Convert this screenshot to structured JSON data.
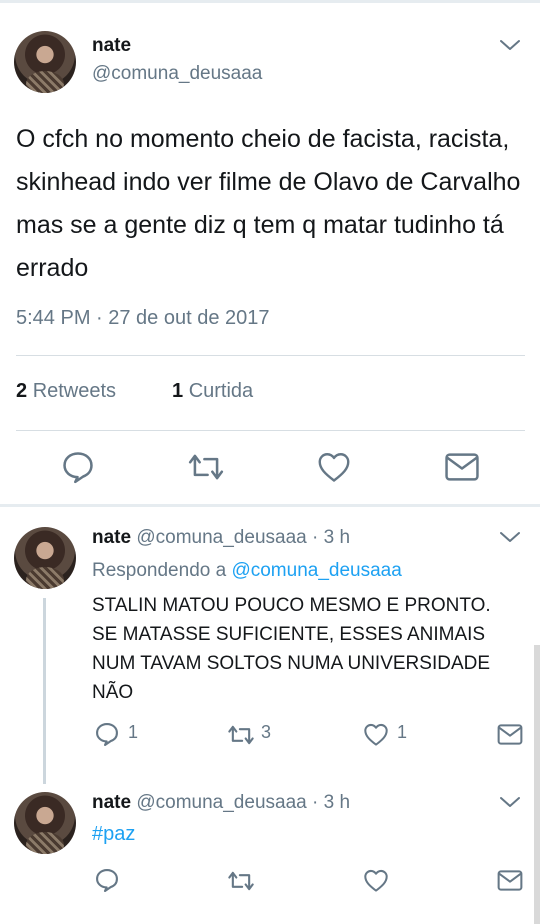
{
  "main_tweet": {
    "author_name": "nate",
    "author_handle": "@comuna_deusaaa",
    "text": "O cfch no momento cheio de facista, racista, skinhead indo ver filme de Olavo de Carvalho mas se a gente diz q tem q matar tudinho tá errado",
    "timestamp": "5:44 PM · 27 de out de 2017",
    "retweets_count": "2",
    "retweets_label": "Retweets",
    "likes_count": "1",
    "likes_label": "Curtida",
    "actions": [
      "reply-icon",
      "retweet-icon",
      "like-icon",
      "message-icon"
    ]
  },
  "replies": [
    {
      "author_name": "nate",
      "author_meta": "@comuna_deusaaa · 3 h",
      "replying_prefix": "Respondendo a ",
      "replying_to": "@comuna_deusaaa",
      "text": "STALIN MATOU POUCO MESMO E PRONTO. SE MATASSE SUFICIENTE, ESSES ANIMAIS NUM TAVAM SOLTOS NUMA UNIVERSIDADE NÃO",
      "reply_count": "1",
      "retweet_count": "3",
      "like_count": "1"
    },
    {
      "author_name": "nate",
      "author_meta": "@comuna_deusaaa · 3 h",
      "text": "#paz"
    }
  ],
  "colors": {
    "accent": "#1da1f2",
    "secondary_text": "#657786",
    "primary_text": "#14171a",
    "divider": "#e6ecf0"
  }
}
